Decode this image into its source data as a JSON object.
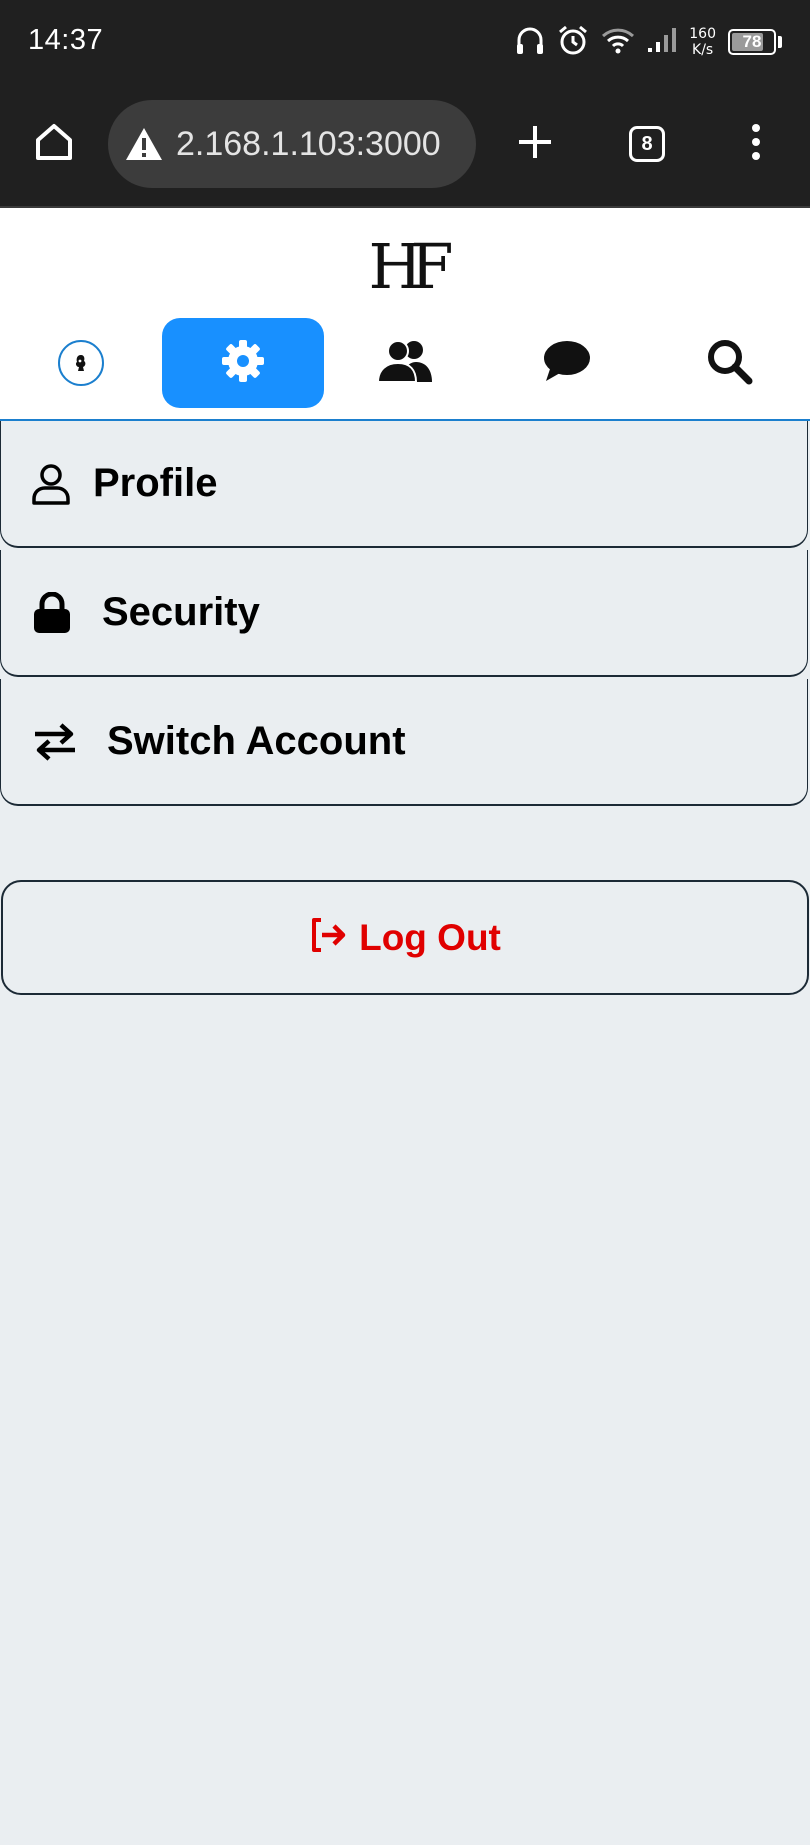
{
  "status_bar": {
    "time": "14:37",
    "net_speed_value": "160",
    "net_speed_unit": "K/s",
    "battery_level": "78",
    "battery_fraction": 0.78,
    "icons": [
      "headphones-icon",
      "alarm-icon",
      "wifi-icon",
      "signal-icon",
      "battery-icon"
    ]
  },
  "browser": {
    "url": "2.168.1.103:3000",
    "tab_count": "8",
    "icons": [
      "home-icon",
      "warning-icon",
      "new-tab-icon",
      "menu-icon"
    ]
  },
  "app": {
    "logo": "HF",
    "nav": [
      {
        "name": "profile-avatar",
        "icon": "avatar-icon",
        "active": false
      },
      {
        "name": "settings",
        "icon": "gear-icon",
        "active": true
      },
      {
        "name": "friends",
        "icon": "users-icon",
        "active": false
      },
      {
        "name": "messages",
        "icon": "chat-icon",
        "active": false
      },
      {
        "name": "search",
        "icon": "search-icon",
        "active": false
      }
    ]
  },
  "settings": {
    "items": [
      {
        "label": "Profile",
        "icon": "user-icon"
      },
      {
        "label": "Security",
        "icon": "lock-icon"
      },
      {
        "label": "Switch Account",
        "icon": "switch-arrows-icon"
      }
    ],
    "logout_label": "Log Out"
  },
  "colors": {
    "accent": "#1890ff",
    "logout": "#e00000",
    "background": "#eaeef1",
    "system_bar": "#202020"
  }
}
